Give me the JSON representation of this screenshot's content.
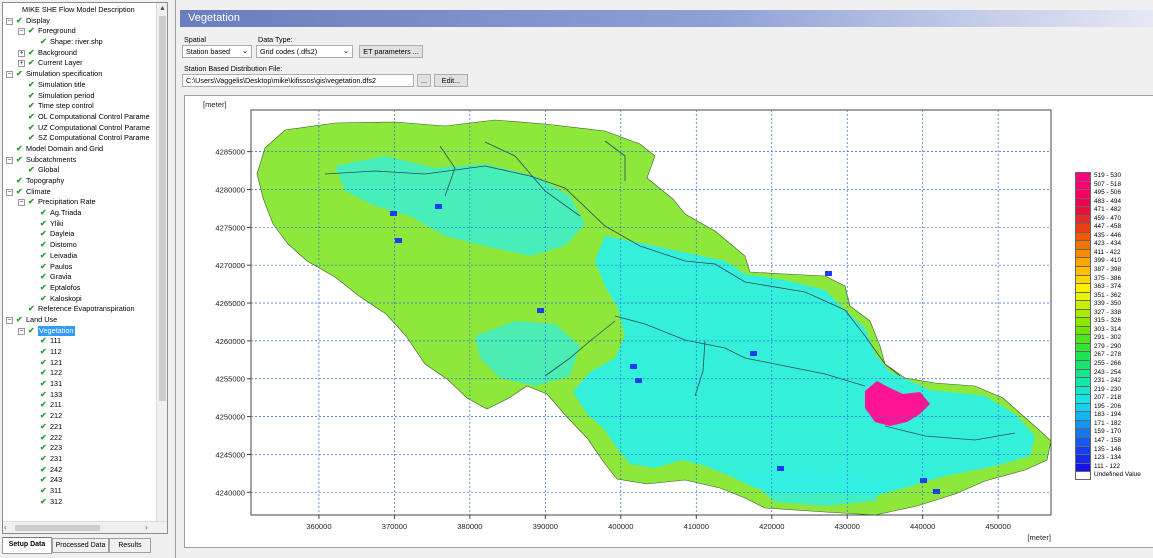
{
  "tree": {
    "items": [
      {
        "label": "MIKE SHE Flow Model Description",
        "level": 0,
        "exp": "",
        "check": false
      },
      {
        "label": "Display",
        "level": 0,
        "exp": "−",
        "check": true
      },
      {
        "label": "Foreground",
        "level": 1,
        "exp": "−",
        "check": true
      },
      {
        "label": "Shape: river.shp",
        "level": 2,
        "exp": "",
        "check": true
      },
      {
        "label": "Background",
        "level": 1,
        "exp": "+",
        "check": true
      },
      {
        "label": "Current Layer",
        "level": 1,
        "exp": "+",
        "check": true
      },
      {
        "label": "Simulation specification",
        "level": 0,
        "exp": "−",
        "check": true
      },
      {
        "label": "Simulation title",
        "level": 1,
        "exp": "",
        "check": true
      },
      {
        "label": "Simulation period",
        "level": 1,
        "exp": "",
        "check": true
      },
      {
        "label": "Time step control",
        "level": 1,
        "exp": "",
        "check": true
      },
      {
        "label": "OL Computational Control Parame",
        "level": 1,
        "exp": "",
        "check": true
      },
      {
        "label": "UZ Computational Control Parame",
        "level": 1,
        "exp": "",
        "check": true
      },
      {
        "label": "SZ Computational Control Parame",
        "level": 1,
        "exp": "",
        "check": true
      },
      {
        "label": "Model Domain and Grid",
        "level": 0,
        "exp": "",
        "check": true
      },
      {
        "label": "Subcatchments",
        "level": 0,
        "exp": "−",
        "check": true
      },
      {
        "label": "Global",
        "level": 1,
        "exp": "",
        "check": true
      },
      {
        "label": "Topography",
        "level": 0,
        "exp": "",
        "check": true
      },
      {
        "label": "Climate",
        "level": 0,
        "exp": "−",
        "check": true
      },
      {
        "label": "Precipitation Rate",
        "level": 1,
        "exp": "−",
        "check": true
      },
      {
        "label": "Ag.Triada",
        "level": 2,
        "exp": "",
        "check": true
      },
      {
        "label": "Yliki",
        "level": 2,
        "exp": "",
        "check": true
      },
      {
        "label": "Dayleia",
        "level": 2,
        "exp": "",
        "check": true
      },
      {
        "label": "Distomo",
        "level": 2,
        "exp": "",
        "check": true
      },
      {
        "label": "Leivadia",
        "level": 2,
        "exp": "",
        "check": true
      },
      {
        "label": "Paulos",
        "level": 2,
        "exp": "",
        "check": true
      },
      {
        "label": "Gravia",
        "level": 2,
        "exp": "",
        "check": true
      },
      {
        "label": "Eptalofos",
        "level": 2,
        "exp": "",
        "check": true
      },
      {
        "label": "Kaloskopi",
        "level": 2,
        "exp": "",
        "check": true
      },
      {
        "label": "Reference Evapotranspiration",
        "level": 1,
        "exp": "",
        "check": true
      },
      {
        "label": "Land Use",
        "level": 0,
        "exp": "−",
        "check": true
      },
      {
        "label": "Vegetation",
        "level": 1,
        "exp": "−",
        "check": true,
        "selected": true
      },
      {
        "label": "111",
        "level": 2,
        "exp": "",
        "check": true
      },
      {
        "label": "112",
        "level": 2,
        "exp": "",
        "check": true
      },
      {
        "label": "121",
        "level": 2,
        "exp": "",
        "check": true
      },
      {
        "label": "122",
        "level": 2,
        "exp": "",
        "check": true
      },
      {
        "label": "131",
        "level": 2,
        "exp": "",
        "check": true
      },
      {
        "label": "133",
        "level": 2,
        "exp": "",
        "check": true
      },
      {
        "label": "211",
        "level": 2,
        "exp": "",
        "check": true
      },
      {
        "label": "212",
        "level": 2,
        "exp": "",
        "check": true
      },
      {
        "label": "221",
        "level": 2,
        "exp": "",
        "check": true
      },
      {
        "label": "222",
        "level": 2,
        "exp": "",
        "check": true
      },
      {
        "label": "223",
        "level": 2,
        "exp": "",
        "check": true
      },
      {
        "label": "231",
        "level": 2,
        "exp": "",
        "check": true
      },
      {
        "label": "242",
        "level": 2,
        "exp": "",
        "check": true
      },
      {
        "label": "243",
        "level": 2,
        "exp": "",
        "check": true
      },
      {
        "label": "311",
        "level": 2,
        "exp": "",
        "check": true
      },
      {
        "label": "312",
        "level": 2,
        "exp": "",
        "check": true
      }
    ]
  },
  "bottom_tabs": [
    "Setup Data",
    "Processed Data",
    "Results"
  ],
  "panel": {
    "title": "Vegetation",
    "spatial_label": "Spatial",
    "spatial_value": "Station based",
    "datatype_label": "Data Type:",
    "datatype_value": "Grid codes (.dfs2)",
    "et_button": "ET parameters ...",
    "file_label": "Station Based Distribution File:",
    "file_value": "C:\\Users\\Vaggelis\\Desktop\\mike\\kifissos\\gis\\vegetation.dfs2",
    "browse_button": "...",
    "edit_button": "Edit..."
  },
  "map": {
    "unit_top": "[meter]",
    "unit_bottom": "[meter]",
    "x_ticks": [
      360000,
      370000,
      380000,
      390000,
      400000,
      410000,
      420000,
      430000,
      440000,
      450000
    ],
    "y_ticks": [
      4285000,
      4280000,
      4275000,
      4270000,
      4265000,
      4260000,
      4255000,
      4250000,
      4245000,
      4240000
    ],
    "x_range": [
      351000,
      457000
    ],
    "y_range": [
      4237000,
      4290500
    ]
  },
  "legend": [
    {
      "label": "519 - 530",
      "color": "#ff007f"
    },
    {
      "label": "507 - 518",
      "color": "#fa0070"
    },
    {
      "label": "495 - 506",
      "color": "#f5005f"
    },
    {
      "label": "483 - 494",
      "color": "#f0004e"
    },
    {
      "label": "471 - 482",
      "color": "#eb103b"
    },
    {
      "label": "459 - 470",
      "color": "#e62a26"
    },
    {
      "label": "447 - 458",
      "color": "#ea3d10"
    },
    {
      "label": "435 - 446",
      "color": "#f05a00"
    },
    {
      "label": "423 - 434",
      "color": "#f57300"
    },
    {
      "label": "411 - 422",
      "color": "#fa8c00"
    },
    {
      "label": "399 - 410",
      "color": "#ffa500"
    },
    {
      "label": "387 - 398",
      "color": "#ffbe00"
    },
    {
      "label": "375 - 386",
      "color": "#ffd700"
    },
    {
      "label": "363 - 374",
      "color": "#fff000"
    },
    {
      "label": "351 - 362",
      "color": "#e6f500"
    },
    {
      "label": "339 - 350",
      "color": "#c8f000"
    },
    {
      "label": "327 - 338",
      "color": "#aaeb00"
    },
    {
      "label": "315 - 326",
      "color": "#8ce600"
    },
    {
      "label": "303 - 314",
      "color": "#6ee600"
    },
    {
      "label": "291 - 302",
      "color": "#50e61e"
    },
    {
      "label": "279 - 290",
      "color": "#32e632"
    },
    {
      "label": "267 - 278",
      "color": "#1ee650"
    },
    {
      "label": "255 - 266",
      "color": "#14e66e"
    },
    {
      "label": "243 - 254",
      "color": "#14e68c"
    },
    {
      "label": "231 - 242",
      "color": "#14e6aa"
    },
    {
      "label": "219 - 230",
      "color": "#14e6c8"
    },
    {
      "label": "207 - 218",
      "color": "#14e6e6"
    },
    {
      "label": "195 - 206",
      "color": "#14d2f0"
    },
    {
      "label": "183 - 194",
      "color": "#14b4f0"
    },
    {
      "label": "171 - 182",
      "color": "#1496f0"
    },
    {
      "label": "159 - 170",
      "color": "#1478f0"
    },
    {
      "label": "147 - 158",
      "color": "#145af0"
    },
    {
      "label": "135 - 146",
      "color": "#143cf0"
    },
    {
      "label": "123 - 134",
      "color": "#1428f0"
    },
    {
      "label": "111 - 122",
      "color": "#1414e6"
    },
    {
      "label": "Undefined Value",
      "color": "#ffffff"
    }
  ],
  "colors": {
    "land_green": "#8ee83c",
    "land_cyan": "#2ff0e4",
    "urban_pink": "#ff1493",
    "water_blue": "#1e3cf0",
    "river_line": "#2a4a5a"
  }
}
